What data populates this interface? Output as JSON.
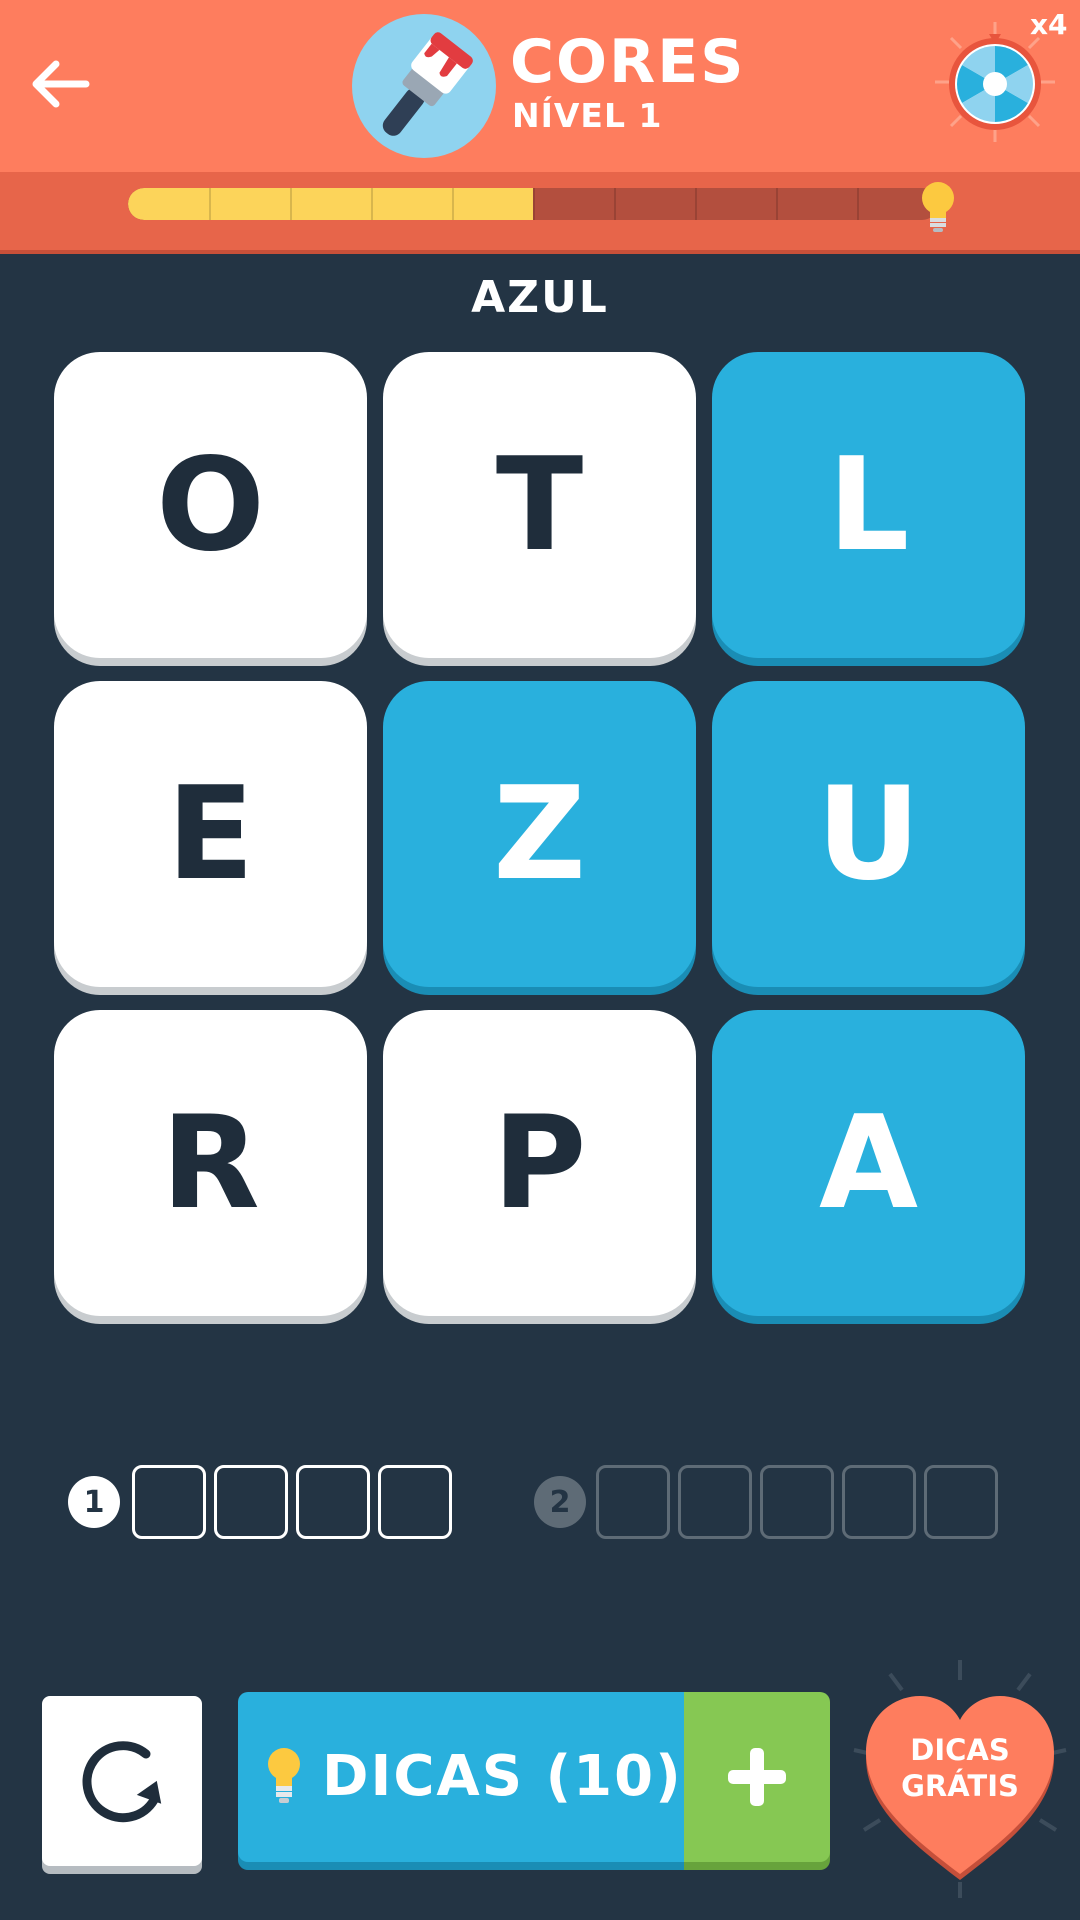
{
  "header": {
    "title": "CORES",
    "level": "NÍVEL 1",
    "multiplier": "x4",
    "back_icon": "arrow-left-icon",
    "category_icon": "paintbrush-icon",
    "wheel_icon": "spin-wheel-icon"
  },
  "progress": {
    "segments_total": 10,
    "segments_done": 5,
    "fraction": 0.5,
    "end_icon": "lightbulb-icon"
  },
  "hint_word": "AZUL",
  "grid": {
    "rows": [
      [
        {
          "letter": "O",
          "state": "white"
        },
        {
          "letter": "T",
          "state": "white"
        },
        {
          "letter": "L",
          "state": "blue"
        }
      ],
      [
        {
          "letter": "E",
          "state": "white"
        },
        {
          "letter": "Z",
          "state": "blue"
        },
        {
          "letter": "U",
          "state": "blue"
        }
      ],
      [
        {
          "letter": "R",
          "state": "white"
        },
        {
          "letter": "P",
          "state": "white"
        },
        {
          "letter": "A",
          "state": "blue"
        }
      ]
    ]
  },
  "answers": [
    {
      "number": "1",
      "length": 4,
      "active": true
    },
    {
      "number": "2",
      "length": 5,
      "active": false
    }
  ],
  "controls": {
    "reset_icon": "refresh-icon",
    "hints_label": "DICAS (10)",
    "hints_icon": "lightbulb-icon",
    "plus_icon": "plus-icon",
    "free_hints_line1": "DICAS",
    "free_hints_line2": "GRÁTIS"
  },
  "colors": {
    "header": "#fe7d5e",
    "background": "#233444",
    "tile_blue": "#29b0dd",
    "tile_white": "#ffffff",
    "plus_green": "#86c853",
    "progress_fill": "#fcd45a"
  }
}
